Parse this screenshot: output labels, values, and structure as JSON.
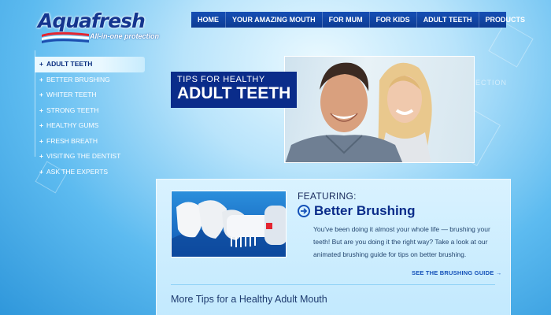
{
  "brand": {
    "name": "Aquafresh",
    "tagline": "All-in-one protection"
  },
  "topnav": [
    {
      "label": "HOME"
    },
    {
      "label": "YOUR AMAZING MOUTH"
    },
    {
      "label": "FOR MUM"
    },
    {
      "label": "FOR KIDS"
    },
    {
      "label": "ADULT TEETH"
    },
    {
      "label": "PRODUCTS"
    }
  ],
  "sidenav": [
    {
      "label": "ADULT TEETH",
      "active": true
    },
    {
      "label": "BETTER BRUSHING"
    },
    {
      "label": "WHITER TEETH"
    },
    {
      "label": "STRONG TEETH"
    },
    {
      "label": "HEALTHY GUMS"
    },
    {
      "label": "FRESH BREATH"
    },
    {
      "label": "VISITING THE DENTIST"
    },
    {
      "label": "ASK THE EXPERTS"
    }
  ],
  "hero": {
    "small": "TIPS FOR HEALTHY",
    "big": "ADULT TEETH",
    "ghost_text": "ECTION"
  },
  "feature": {
    "featuring_label": "FEATURING:",
    "title": "Better Brushing",
    "body": "You've been doing it almost your whole life — brushing your teeth!  But are you doing it the right way?  Take a look at our animated brushing guide for tips on better brushing.",
    "link_label": "SEE THE BRUSHING GUIDE"
  },
  "more_tips": {
    "title": "More Tips for a Healthy Adult Mouth"
  },
  "colors": {
    "brand_navy": "#0a2c8a",
    "nav_blue": "#164fb5",
    "sky_light": "#eaf9ff",
    "sky_dark": "#2f97db",
    "stripe_red": "#e42530"
  },
  "icons": {
    "plus": "plus-icon",
    "arrow": "circle-arrow-right-icon",
    "link_arrow": "arrow-right-icon"
  }
}
